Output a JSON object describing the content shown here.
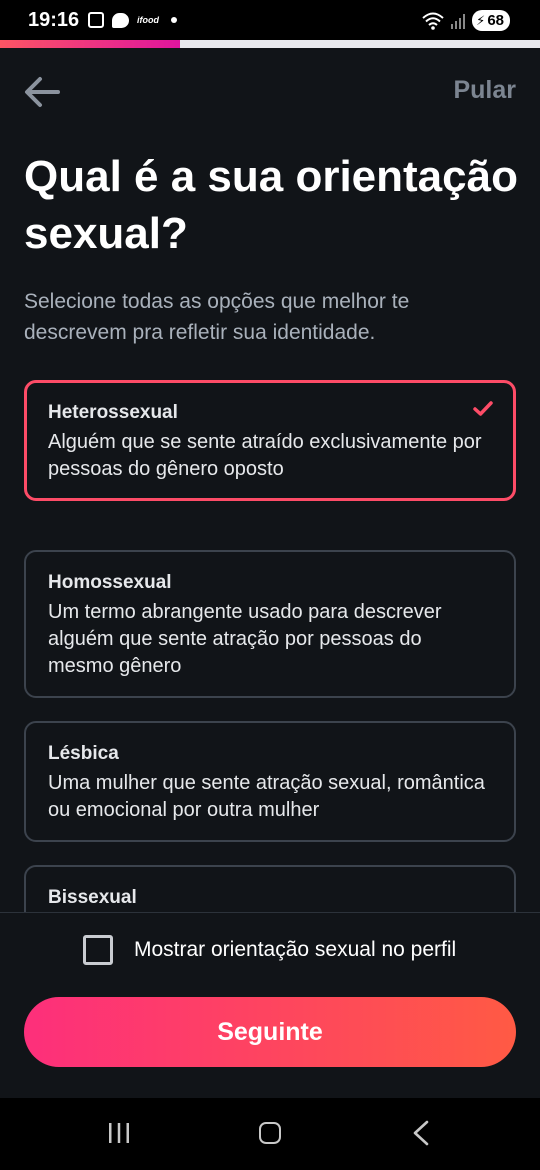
{
  "status_bar": {
    "time": "19:16",
    "notification_tag": "ifood",
    "battery_level": "68",
    "signal_tag": "5"
  },
  "progress": {
    "fraction": 0.333
  },
  "header": {
    "skip_label": "Pular"
  },
  "title": "Qual é a sua orientação sexual?",
  "subtitle": "Selecione todas as opções que melhor te descrevem pra refletir sua identidade.",
  "options": [
    {
      "title": "Heterossexual",
      "description": "Alguém que se sente atraído exclusivamente por pessoas do gênero oposto",
      "selected": true
    },
    {
      "title": "Homossexual",
      "description": "Um termo abrangente usado para descrever alguém que sente atração por pessoas do mesmo gênero",
      "selected": false
    },
    {
      "title": "Lésbica",
      "description": "Uma mulher que sente atração sexual, romântica ou emocional por outra mulher",
      "selected": false
    },
    {
      "title": "Bissexual",
      "description": "",
      "selected": false
    }
  ],
  "show_on_profile": {
    "label": "Mostrar orientação sexual no perfil",
    "checked": false
  },
  "next_button": {
    "label": "Seguinte"
  },
  "colors": {
    "accent": "#fd4c67",
    "background": "#111418",
    "gradient_start": "#fd2f7b",
    "gradient_end": "#ff5a44"
  },
  "icons": [
    "back-arrow-icon",
    "check-icon",
    "wifi-icon",
    "signal-icon",
    "recents-icon",
    "home-icon",
    "nav-back-icon"
  ]
}
